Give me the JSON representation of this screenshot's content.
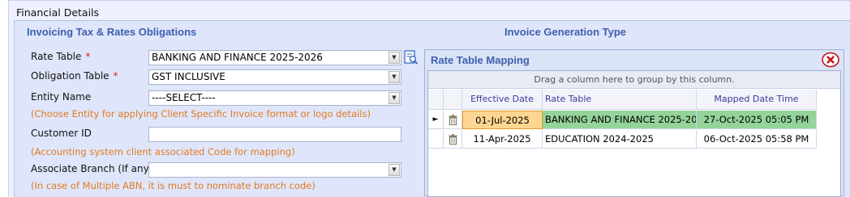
{
  "panel": {
    "title": "Financial Details"
  },
  "invoicing": {
    "title": "Invoicing Tax & Rates Obligations",
    "rate_table": {
      "label": "Rate Table",
      "required_mark": "*",
      "value": "BANKING AND FINANCE 2025-2026"
    },
    "obligation_table": {
      "label": "Obligation Table",
      "required_mark": "*",
      "value": "GST INCLUSIVE"
    },
    "entity_name": {
      "label": "Entity Name",
      "value": "----SELECT----",
      "hint": "(Choose Entity for applying Client Specific Invoice format or logo details)"
    },
    "customer_id": {
      "label": "Customer ID",
      "value": "",
      "hint": "(Accounting system client associated Code for mapping)"
    },
    "associate_branch": {
      "label": "Associate Branch (If any)",
      "value": "",
      "hint": "(In case of Multiple ABN, it is must to nominate branch code)"
    }
  },
  "invoice_generation": {
    "title": "Invoice Generation Type"
  },
  "rate_mapping": {
    "title": "Rate Table Mapping",
    "group_hint": "Drag a column here to group by this column.",
    "columns": [
      "Effective Date",
      "Rate Table",
      "Mapped Date Time"
    ],
    "rows": [
      {
        "effective_date": "01-Jul-2025",
        "rate_table": "BANKING AND FINANCE 2025-2026",
        "mapped": "27-Oct-2025 05:05 PM",
        "selected": true
      },
      {
        "effective_date": "11-Apr-2025",
        "rate_table": "EDUCATION 2024-2025",
        "mapped": "06-Oct-2025 05:58 PM",
        "selected": false
      }
    ]
  },
  "colors": {
    "section_title": "#3d5fae",
    "hint": "#e07a1f",
    "selected_row": "#94d49b"
  }
}
